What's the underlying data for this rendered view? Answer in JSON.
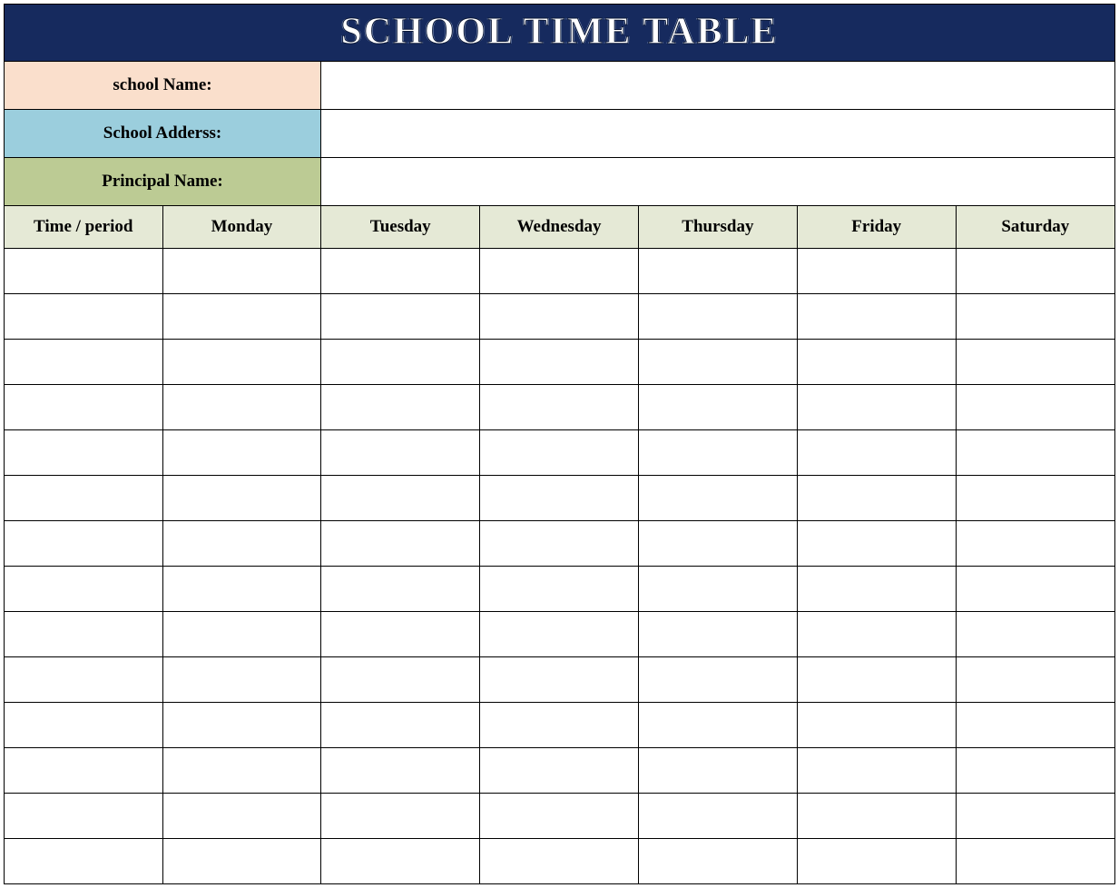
{
  "title": "SCHOOL TIME TABLE",
  "info": {
    "school_name_label": "school Name:",
    "school_name_value": "",
    "school_address_label": "School Adderss:",
    "school_address_value": "",
    "principal_name_label": "Principal Name:",
    "principal_name_value": ""
  },
  "headers": [
    "Time / period",
    "Monday",
    "Tuesday",
    "Wednesday",
    "Thursday",
    "Friday",
    "Saturday"
  ],
  "rows": [
    [
      "",
      "",
      "",
      "",
      "",
      "",
      ""
    ],
    [
      "",
      "",
      "",
      "",
      "",
      "",
      ""
    ],
    [
      "",
      "",
      "",
      "",
      "",
      "",
      ""
    ],
    [
      "",
      "",
      "",
      "",
      "",
      "",
      ""
    ],
    [
      "",
      "",
      "",
      "",
      "",
      "",
      ""
    ],
    [
      "",
      "",
      "",
      "",
      "",
      "",
      ""
    ],
    [
      "",
      "",
      "",
      "",
      "",
      "",
      ""
    ],
    [
      "",
      "",
      "",
      "",
      "",
      "",
      ""
    ],
    [
      "",
      "",
      "",
      "",
      "",
      "",
      ""
    ],
    [
      "",
      "",
      "",
      "",
      "",
      "",
      ""
    ],
    [
      "",
      "",
      "",
      "",
      "",
      "",
      ""
    ],
    [
      "",
      "",
      "",
      "",
      "",
      "",
      ""
    ],
    [
      "",
      "",
      "",
      "",
      "",
      "",
      ""
    ],
    [
      "",
      "",
      "",
      "",
      "",
      "",
      ""
    ]
  ]
}
